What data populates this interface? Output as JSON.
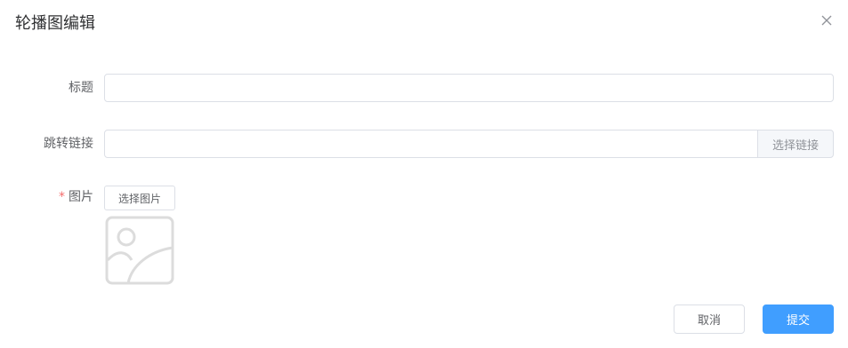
{
  "dialog": {
    "title": "轮播图编辑",
    "close_icon": "close-icon"
  },
  "form": {
    "title_field": {
      "label": "标题",
      "value": "",
      "placeholder": ""
    },
    "link_field": {
      "label": "跳转链接",
      "value": "",
      "placeholder": "",
      "append_button_label": "选择链接"
    },
    "image_field": {
      "required_mark": "*",
      "label": "图片",
      "select_button_label": "选择图片",
      "placeholder_icon": "image-placeholder-icon"
    }
  },
  "footer": {
    "cancel_label": "取消",
    "submit_label": "提交"
  },
  "colors": {
    "primary": "#409eff",
    "required": "#f56c6c",
    "border": "#dcdfe6"
  }
}
